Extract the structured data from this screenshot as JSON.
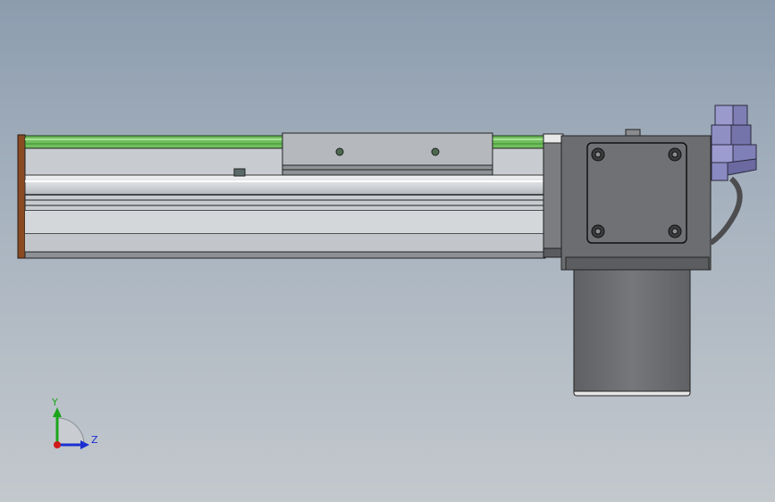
{
  "triad": {
    "y_label": "Y",
    "z_label": "Z",
    "colors": {
      "y_axis": "#1aa51a",
      "z_axis": "#1a2fd0",
      "x_axis": "#d01a1a"
    }
  },
  "colors": {
    "background_top": "#8c9cae",
    "background_bottom": "#c3c8cd",
    "rail_green": "#7fd06a",
    "end_plate": "#8a4a22",
    "extrusion": "#d9dcdf",
    "motor_body": "#6f7073",
    "connector": "#8e8ec4"
  }
}
